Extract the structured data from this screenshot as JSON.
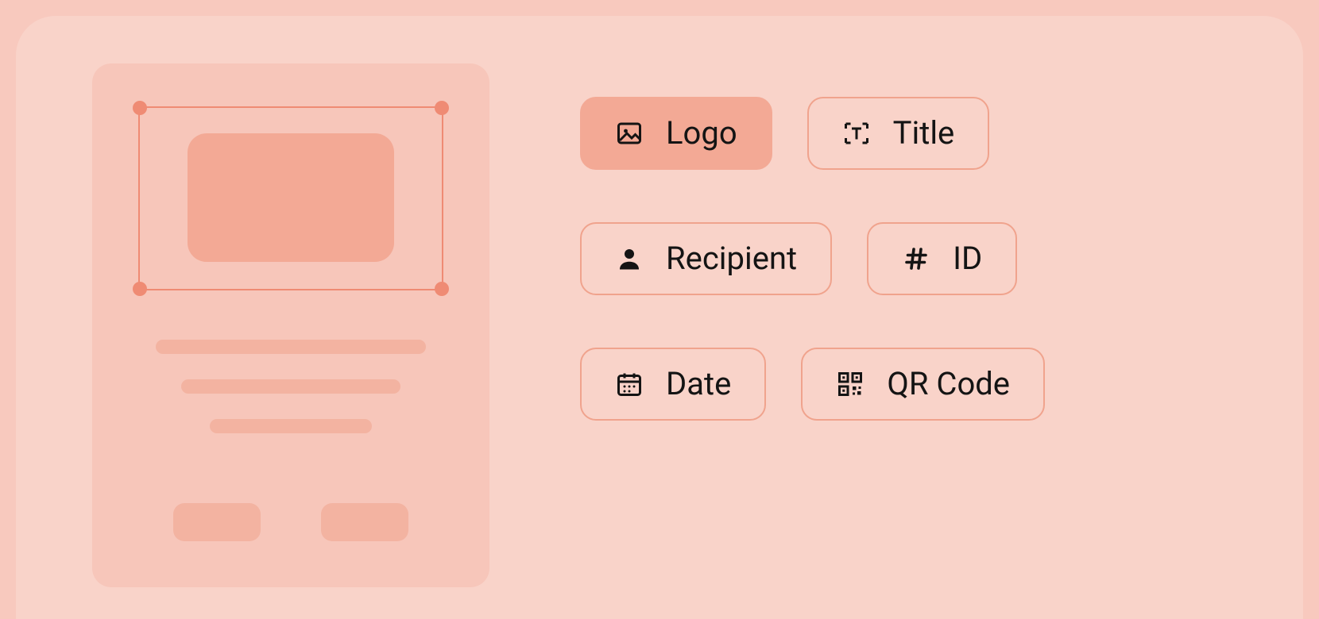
{
  "options": {
    "logo": {
      "label": "Logo",
      "selected": true
    },
    "title": {
      "label": "Title",
      "selected": false
    },
    "recipient": {
      "label": "Recipient",
      "selected": false
    },
    "id": {
      "label": "ID",
      "selected": false
    },
    "date": {
      "label": "Date",
      "selected": false
    },
    "qr": {
      "label": "QR Code",
      "selected": false
    }
  },
  "colors": {
    "page_bg": "#f8c9be",
    "panel_bg": "#f9d3c9",
    "card_bg": "#f7c6ba",
    "shape": "#f3b3a1",
    "accent": "#f3a995",
    "stroke": "#ef8b74",
    "text": "#141414"
  }
}
